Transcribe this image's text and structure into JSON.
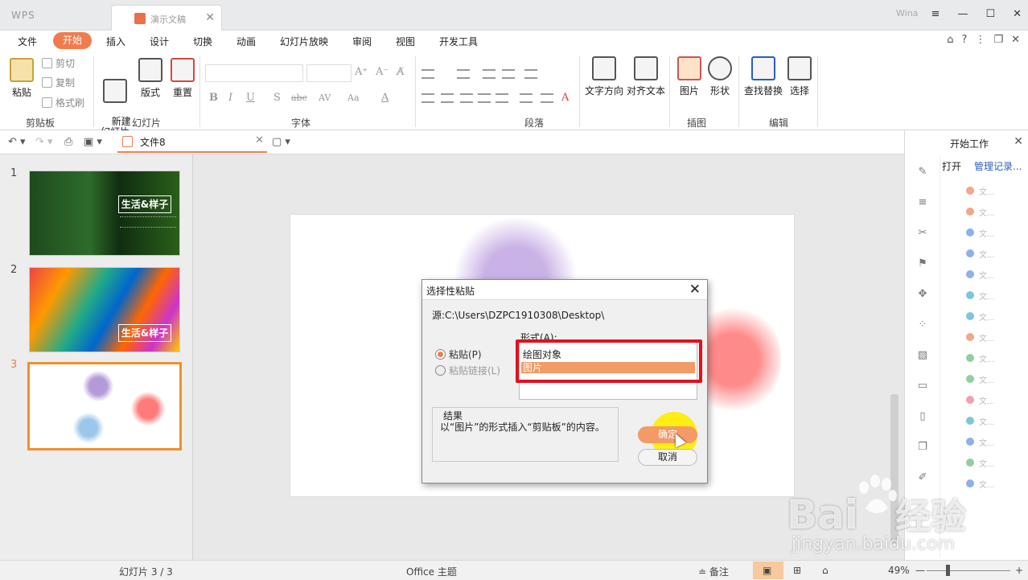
{
  "title_bar": {
    "app_logo": "WPS",
    "doc_tab": "演示文稿",
    "user": "Wina",
    "window_controls": [
      "≡",
      "—",
      "☐",
      "✕"
    ]
  },
  "menu": {
    "items": [
      "文件",
      "开始",
      "插入",
      "设计",
      "切换",
      "动画",
      "幻灯片放映",
      "审阅",
      "视图",
      "开发工具"
    ],
    "active": "开始",
    "right_icons": [
      "⌂",
      "?",
      "⋮",
      "❐",
      "✕"
    ]
  },
  "ribbon": {
    "clipboard": {
      "paste": "粘贴",
      "cut": "剪切",
      "copy": "复制",
      "format_painter": "格式刷",
      "label": "剪贴板"
    },
    "slides": {
      "new_slide": "新建\n幻灯片",
      "layout": "版式",
      "reset": "重置",
      "label": "幻灯片"
    },
    "font": {
      "label": "字体",
      "bold": "B",
      "italic": "I",
      "underline": "U",
      "shadow": "S",
      "strike": "abc",
      "spacing": "AV",
      "case": "Aa",
      "color": "A"
    },
    "paragraph": {
      "label": "段落"
    },
    "text_direction": "文字方向",
    "align_text": "对齐文本",
    "insert": {
      "picture": "图片",
      "shape": "形状",
      "label": "插图"
    },
    "edit": {
      "find_replace": "查找替换",
      "select": "选择",
      "label": "编辑"
    }
  },
  "qat": {
    "file_tab": "文件8"
  },
  "thumbnails": {
    "numbers": [
      "1",
      "2",
      "3"
    ],
    "caption": "生活&样子"
  },
  "side_panel": {
    "title": "开始工作",
    "open": "打开",
    "manage": "管理记录...",
    "recent_label": "文..."
  },
  "dialog": {
    "title": "选择性粘贴",
    "source": "源:C:\\Users\\DZPC1910308\\Desktop\\",
    "form_label": "形式(A):",
    "options": [
      "绘图对象",
      "图片"
    ],
    "selected": "图片",
    "radio_paste": "粘贴(P)",
    "radio_paste_link": "粘贴链接(L)",
    "result_head": "结果",
    "result_text": "以“图片”的形式插入“剪贴板”的内容。",
    "ok": "确定",
    "cancel": "取消",
    "close": "✕"
  },
  "status": {
    "slide_pos": "幻灯片 3 / 3",
    "theme": "Office 主题",
    "notes": "备注",
    "zoom": "49%",
    "zoom_minus": "—",
    "zoom_plus": "+"
  },
  "watermark": {
    "brand": "Bai",
    "brand_cn": "经验",
    "url": "jingyan.baidu.com"
  },
  "colors": {
    "accent": "#f07c4e",
    "highlight": "#e3101c",
    "cursor_spot": "#ffee00"
  }
}
